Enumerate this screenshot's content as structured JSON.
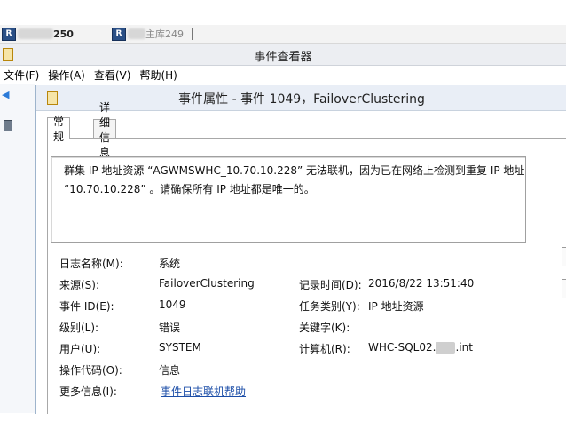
{
  "remote_tabs": [
    {
      "icon": "R",
      "label": "250"
    },
    {
      "icon": "R",
      "label": "主库249"
    }
  ],
  "window": {
    "title": "事件查看器"
  },
  "menu": [
    "文件(F)",
    "操作(A)",
    "查看(V)",
    "帮助(H)"
  ],
  "dialog": {
    "title": "事件属性 - 事件 1049，FailoverClustering",
    "tabs": [
      "常规",
      "详细信息"
    ],
    "description": "群集 IP 地址资源 “AGWMSWHC_10.70.10.228” 无法联机，因为已在网络上检测到重复 IP 地址\n“10.70.10.228” 。请确保所有 IP 地址都是唯一的。",
    "fields": {
      "log_name": {
        "label": "日志名称(M):",
        "value": "系统"
      },
      "source": {
        "label": "来源(S):",
        "value": "FailoverClustering"
      },
      "logged": {
        "label": "记录时间(D):",
        "value": "2016/8/22 13:51:40"
      },
      "event_id": {
        "label": "事件 ID(E):",
        "value": "1049"
      },
      "task_category": {
        "label": "任务类别(Y):",
        "value": "IP 地址资源"
      },
      "level": {
        "label": "级别(L):",
        "value": "错误"
      },
      "keywords": {
        "label": "关键字(K):",
        "value": ""
      },
      "user": {
        "label": "用户(U):",
        "value": "SYSTEM"
      },
      "computer": {
        "label": "计算机(R):",
        "value_prefix": "WHC-SQL02.",
        "value_suffix": ".int"
      },
      "opcode": {
        "label": "操作代码(O):",
        "value": "信息"
      },
      "more_info": {
        "label": "更多信息(I):",
        "value": "事件日志联机帮助"
      }
    }
  }
}
